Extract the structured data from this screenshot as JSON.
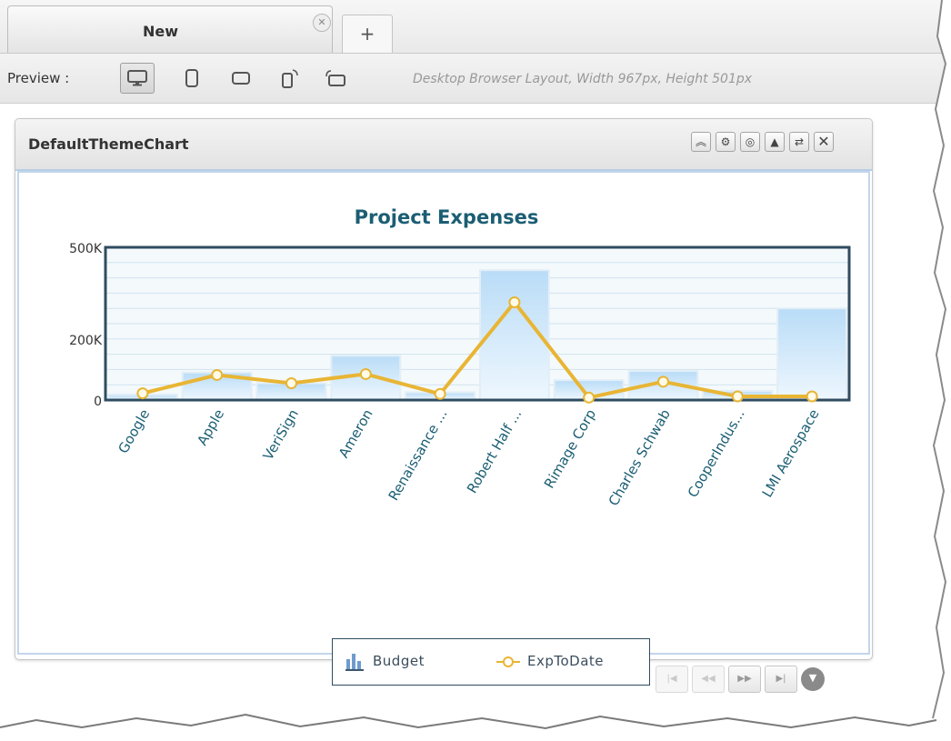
{
  "tabs": {
    "active_label": "New",
    "close_icon": "close-icon",
    "add_label": "+"
  },
  "toolbar": {
    "preview_label": "Preview :",
    "devices": [
      "desktop",
      "tablet-portrait",
      "tablet-landscape",
      "phone-portrait",
      "phone-landscape"
    ],
    "active_device": "desktop",
    "layout_description": "Desktop Browser Layout, Width 967px, Height 501px"
  },
  "widget": {
    "title": "DefaultThemeChart",
    "header_buttons": [
      "collapse-icon",
      "settings-icon",
      "theme-icon",
      "chart-type-icon",
      "refresh-icon",
      "close-icon"
    ]
  },
  "colors": {
    "bar_top": "#b9dcf7",
    "bar_bottom": "#eef7fe",
    "line": "#e8b534",
    "axis": "#2f4c60",
    "title": "#1b5e73",
    "label": "#1b5e73"
  },
  "chart_data": {
    "type": "bar",
    "title": "Project Expenses",
    "categories": [
      "Google",
      "Apple",
      "VeriSign",
      "Ameron",
      "Renaissance ...",
      "Robert Half ...",
      "Rimage Corp",
      "Charles Schwab",
      "CooperIndus...",
      "LMI Aerospace"
    ],
    "series": [
      {
        "name": "Budget",
        "type": "bar",
        "values": [
          18000,
          90000,
          55000,
          145000,
          25000,
          425000,
          65000,
          95000,
          30000,
          300000
        ]
      },
      {
        "name": "ExpToDate",
        "type": "line",
        "values": [
          22000,
          82000,
          55000,
          85000,
          20000,
          320000,
          8000,
          60000,
          12000,
          12000
        ]
      }
    ],
    "y_ticks": [
      "0",
      "200K",
      "500K"
    ],
    "y_tick_values": [
      0,
      200000,
      500000
    ],
    "ylim": [
      0,
      500000
    ],
    "grid": true,
    "legend_position": "bottom"
  },
  "pager": {
    "buttons": [
      "first",
      "prev",
      "next",
      "last"
    ],
    "enabled": [
      false,
      false,
      true,
      true
    ],
    "first_label": "|◀",
    "prev_label": "◀◀",
    "next_label": "▶▶",
    "last_label": "▶|",
    "menu_label": "▼"
  }
}
